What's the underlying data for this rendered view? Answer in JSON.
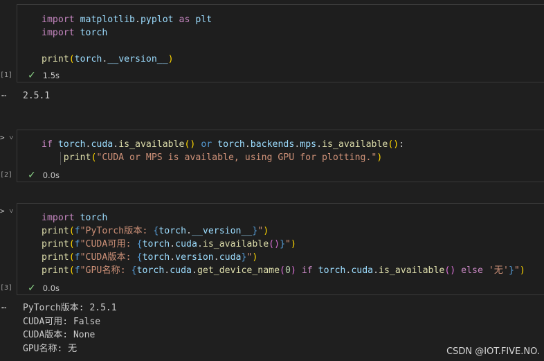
{
  "cells": [
    {
      "exec_count": "[1]",
      "status_time": "1.5s",
      "lines": [
        [
          [
            "kw",
            "import "
          ],
          [
            "var",
            "matplotlib"
          ],
          [
            "plain",
            "."
          ],
          [
            "var",
            "pyplot"
          ],
          [
            "kw",
            " as "
          ],
          [
            "var",
            "plt"
          ]
        ],
        [
          [
            "kw",
            "import "
          ],
          [
            "var",
            "torch"
          ]
        ],
        [],
        [
          [
            "fn",
            "print"
          ],
          [
            "br1",
            "("
          ],
          [
            "var",
            "torch"
          ],
          [
            "plain",
            "."
          ],
          [
            "var",
            "__version__"
          ],
          [
            "br1",
            ")"
          ]
        ]
      ],
      "output": [
        "2.5.1"
      ]
    },
    {
      "exec_count": "[2]",
      "status_time": "0.0s",
      "lines": [
        [
          [
            "kw",
            "if "
          ],
          [
            "var",
            "torch"
          ],
          [
            "plain",
            "."
          ],
          [
            "var",
            "cuda"
          ],
          [
            "plain",
            "."
          ],
          [
            "fn",
            "is_available"
          ],
          [
            "br1",
            "()"
          ],
          [
            "kwb",
            " or "
          ],
          [
            "var",
            "torch"
          ],
          [
            "plain",
            "."
          ],
          [
            "var",
            "backends"
          ],
          [
            "plain",
            "."
          ],
          [
            "var",
            "mps"
          ],
          [
            "plain",
            "."
          ],
          [
            "fn",
            "is_available"
          ],
          [
            "br1",
            "()"
          ],
          [
            "plain",
            ":"
          ]
        ],
        [
          [
            "plain",
            "    "
          ],
          [
            "fn",
            "print"
          ],
          [
            "br1",
            "("
          ],
          [
            "str",
            "\"CUDA or MPS is available, using GPU for plotting.\""
          ],
          [
            "br1",
            ")"
          ]
        ]
      ],
      "output": []
    },
    {
      "exec_count": "[3]",
      "status_time": "0.0s",
      "lines": [
        [
          [
            "kw",
            "import "
          ],
          [
            "var",
            "torch"
          ]
        ],
        [
          [
            "fn",
            "print"
          ],
          [
            "br1",
            "("
          ],
          [
            "kwb",
            "f"
          ],
          [
            "str",
            "\"PyTorch版本: "
          ],
          [
            "kwb",
            "{"
          ],
          [
            "var",
            "torch"
          ],
          [
            "plain",
            "."
          ],
          [
            "var",
            "__version__"
          ],
          [
            "kwb",
            "}"
          ],
          [
            "str",
            "\""
          ],
          [
            "br1",
            ")"
          ]
        ],
        [
          [
            "fn",
            "print"
          ],
          [
            "br1",
            "("
          ],
          [
            "kwb",
            "f"
          ],
          [
            "str",
            "\"CUDA可用: "
          ],
          [
            "kwb",
            "{"
          ],
          [
            "var",
            "torch"
          ],
          [
            "plain",
            "."
          ],
          [
            "var",
            "cuda"
          ],
          [
            "plain",
            "."
          ],
          [
            "fn",
            "is_available"
          ],
          [
            "br2",
            "()"
          ],
          [
            "kwb",
            "}"
          ],
          [
            "str",
            "\""
          ],
          [
            "br1",
            ")"
          ]
        ],
        [
          [
            "fn",
            "print"
          ],
          [
            "br1",
            "("
          ],
          [
            "kwb",
            "f"
          ],
          [
            "str",
            "\"CUDA版本: "
          ],
          [
            "kwb",
            "{"
          ],
          [
            "var",
            "torch"
          ],
          [
            "plain",
            "."
          ],
          [
            "var",
            "version"
          ],
          [
            "plain",
            "."
          ],
          [
            "var",
            "cuda"
          ],
          [
            "kwb",
            "}"
          ],
          [
            "str",
            "\""
          ],
          [
            "br1",
            ")"
          ]
        ],
        [
          [
            "fn",
            "print"
          ],
          [
            "br1",
            "("
          ],
          [
            "kwb",
            "f"
          ],
          [
            "str",
            "\"GPU名称: "
          ],
          [
            "kwb",
            "{"
          ],
          [
            "var",
            "torch"
          ],
          [
            "plain",
            "."
          ],
          [
            "var",
            "cuda"
          ],
          [
            "plain",
            "."
          ],
          [
            "fn",
            "get_device_name"
          ],
          [
            "br2",
            "("
          ],
          [
            "num",
            "0"
          ],
          [
            "br2",
            ")"
          ],
          [
            "kw",
            " if "
          ],
          [
            "var",
            "torch"
          ],
          [
            "plain",
            "."
          ],
          [
            "var",
            "cuda"
          ],
          [
            "plain",
            "."
          ],
          [
            "fn",
            "is_available"
          ],
          [
            "br2",
            "()"
          ],
          [
            "kw",
            " else "
          ],
          [
            "str",
            "'无'"
          ],
          [
            "kwb",
            "}"
          ],
          [
            "str",
            "\""
          ],
          [
            "br1",
            ")"
          ]
        ]
      ],
      "output": [
        "PyTorch版本: 2.5.1",
        "CUDA可用: False",
        "CUDA版本: None",
        "GPU名称: 无"
      ]
    }
  ],
  "output_dots": "…",
  "run_toggle": "> ˅",
  "watermark": "CSDN @IOT.FIVE.NO."
}
